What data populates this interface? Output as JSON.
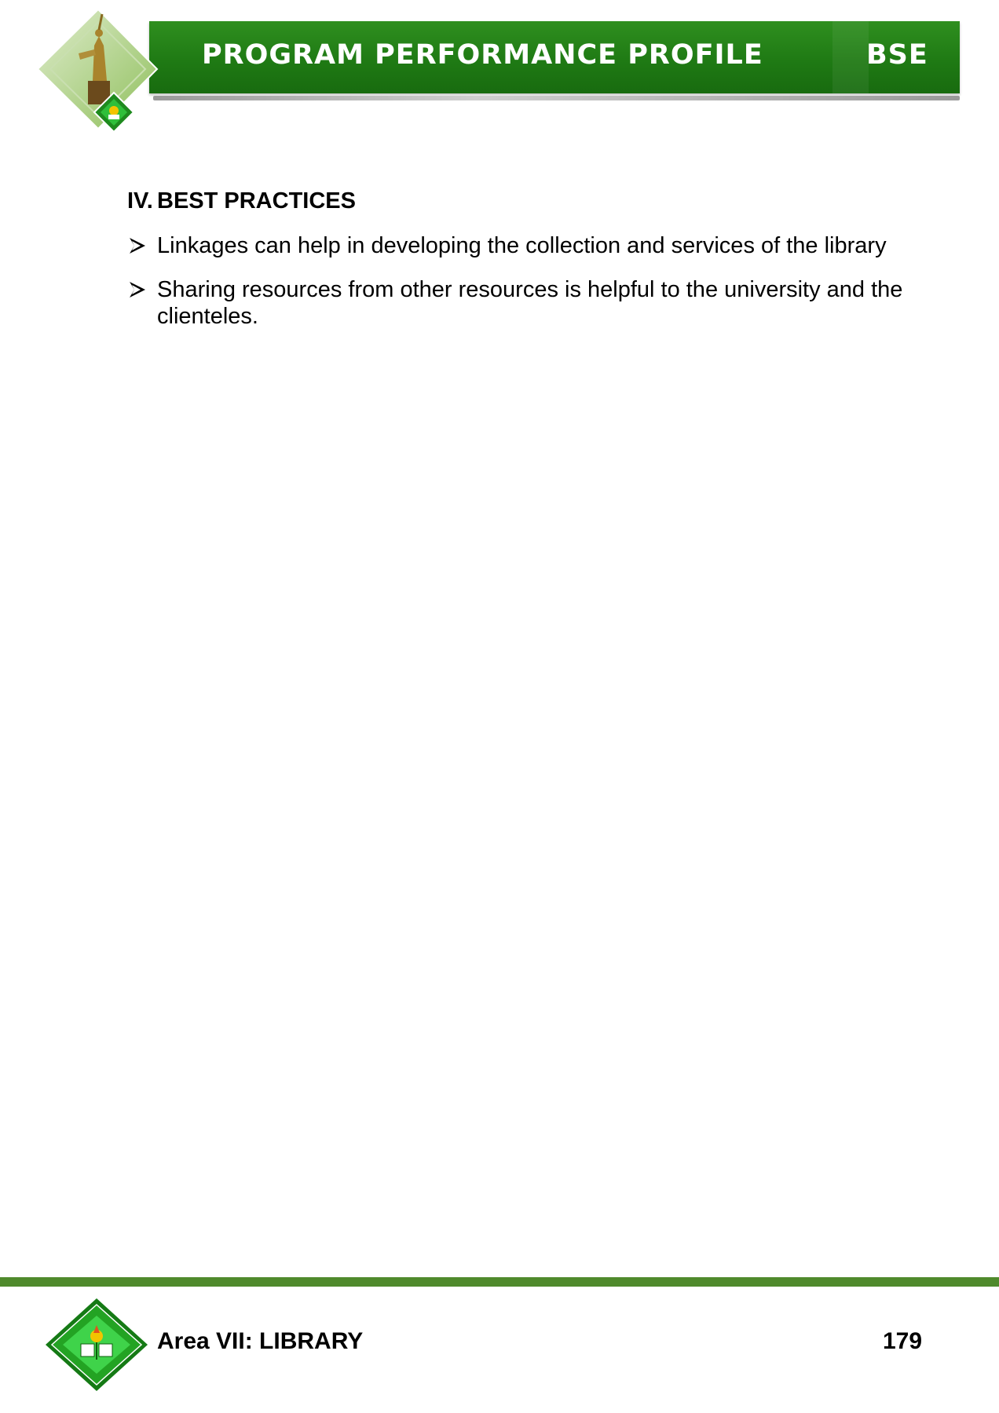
{
  "header": {
    "title": "PROGRAM PERFORMANCE PROFILE",
    "program_code": "BSE",
    "brand_color": "#1f7a14",
    "emblem_icon": "university-statue-emblem-icon"
  },
  "content": {
    "section_number": "IV.",
    "section_title": "BEST PRACTICES",
    "bullet_icon": "arrowhead-bullet-icon",
    "bullets": [
      "Linkages can help in developing the collection and services of the library",
      "Sharing resources from other resources is helpful to the university and the clienteles."
    ]
  },
  "footer": {
    "area_label": "Area VII: LIBRARY",
    "page_number": "179",
    "rule_color": "#4f8a2c",
    "seal_icon": "university-seal-icon"
  }
}
